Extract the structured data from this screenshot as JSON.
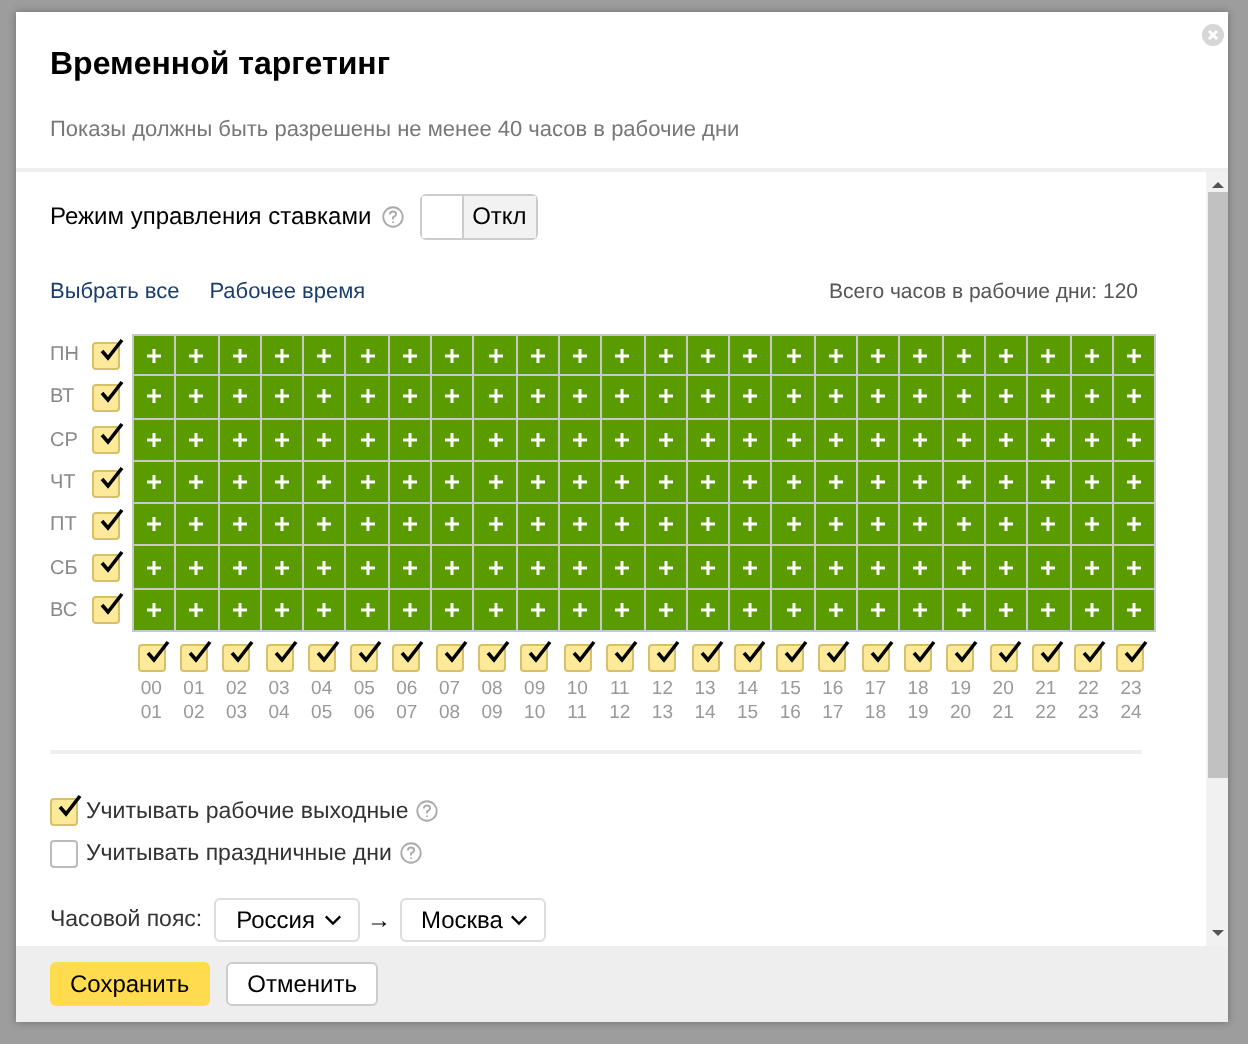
{
  "dialog": {
    "title": "Временной таргетинг",
    "subtitle": "Показы должны быть разрешены не менее 40 часов в рабочие дни"
  },
  "bid_mode": {
    "label": "Режим управления ставками",
    "on": false,
    "value": "Откл"
  },
  "links": [
    "Выбрать все",
    "Рабочее время"
  ],
  "total": "Всего часов в рабочие дни: 120",
  "days": [
    {
      "label": "ПН",
      "checked": true,
      "cells": [
        true,
        true,
        true,
        true,
        true,
        true,
        true,
        true,
        true,
        true,
        true,
        true,
        true,
        true,
        true,
        true,
        true,
        true,
        true,
        true,
        true,
        true,
        true,
        true
      ]
    },
    {
      "label": "ВТ",
      "checked": true,
      "cells": [
        true,
        true,
        true,
        true,
        true,
        true,
        true,
        true,
        true,
        true,
        true,
        true,
        true,
        true,
        true,
        true,
        true,
        true,
        true,
        true,
        true,
        true,
        true,
        true
      ]
    },
    {
      "label": "СР",
      "checked": true,
      "cells": [
        true,
        true,
        true,
        true,
        true,
        true,
        true,
        true,
        true,
        true,
        true,
        true,
        true,
        true,
        true,
        true,
        true,
        true,
        true,
        true,
        true,
        true,
        true,
        true
      ]
    },
    {
      "label": "ЧТ",
      "checked": true,
      "cells": [
        true,
        true,
        true,
        true,
        true,
        true,
        true,
        true,
        true,
        true,
        true,
        true,
        true,
        true,
        true,
        true,
        true,
        true,
        true,
        true,
        true,
        true,
        true,
        true
      ]
    },
    {
      "label": "ПТ",
      "checked": true,
      "cells": [
        true,
        true,
        true,
        true,
        true,
        true,
        true,
        true,
        true,
        true,
        true,
        true,
        true,
        true,
        true,
        true,
        true,
        true,
        true,
        true,
        true,
        true,
        true,
        true
      ]
    },
    {
      "label": "СБ",
      "checked": true,
      "cells": [
        true,
        true,
        true,
        true,
        true,
        true,
        true,
        true,
        true,
        true,
        true,
        true,
        true,
        true,
        true,
        true,
        true,
        true,
        true,
        true,
        true,
        true,
        true,
        true
      ]
    },
    {
      "label": "ВС",
      "checked": true,
      "cells": [
        true,
        true,
        true,
        true,
        true,
        true,
        true,
        true,
        true,
        true,
        true,
        true,
        true,
        true,
        true,
        true,
        true,
        true,
        true,
        true,
        true,
        true,
        true,
        true
      ]
    }
  ],
  "hours": [
    {
      "from": "00",
      "to": "01",
      "checked": true
    },
    {
      "from": "01",
      "to": "02",
      "checked": true
    },
    {
      "from": "02",
      "to": "03",
      "checked": true
    },
    {
      "from": "03",
      "to": "04",
      "checked": true
    },
    {
      "from": "04",
      "to": "05",
      "checked": true
    },
    {
      "from": "05",
      "to": "06",
      "checked": true
    },
    {
      "from": "06",
      "to": "07",
      "checked": true
    },
    {
      "from": "07",
      "to": "08",
      "checked": true
    },
    {
      "from": "08",
      "to": "09",
      "checked": true
    },
    {
      "from": "09",
      "to": "10",
      "checked": true
    },
    {
      "from": "10",
      "to": "11",
      "checked": true
    },
    {
      "from": "11",
      "to": "12",
      "checked": true
    },
    {
      "from": "12",
      "to": "13",
      "checked": true
    },
    {
      "from": "13",
      "to": "14",
      "checked": true
    },
    {
      "from": "14",
      "to": "15",
      "checked": true
    },
    {
      "from": "15",
      "to": "16",
      "checked": true
    },
    {
      "from": "16",
      "to": "17",
      "checked": true
    },
    {
      "from": "17",
      "to": "18",
      "checked": true
    },
    {
      "from": "18",
      "to": "19",
      "checked": true
    },
    {
      "from": "19",
      "to": "20",
      "checked": true
    },
    {
      "from": "20",
      "to": "21",
      "checked": true
    },
    {
      "from": "21",
      "to": "22",
      "checked": true
    },
    {
      "from": "22",
      "to": "23",
      "checked": true
    },
    {
      "from": "23",
      "to": "24",
      "checked": true
    }
  ],
  "options": [
    {
      "label": "Учитывать рабочие выходные",
      "checked": true
    },
    {
      "label": "Учитывать праздничные дни",
      "checked": false
    }
  ],
  "timezone": {
    "label": "Часовой пояс:",
    "country": "Россия",
    "arrow": "→",
    "city": "Москва"
  },
  "buttons": [
    {
      "label": "Сохранить",
      "kind": "primary"
    },
    {
      "label": "Отменить",
      "kind": "secondary"
    }
  ]
}
